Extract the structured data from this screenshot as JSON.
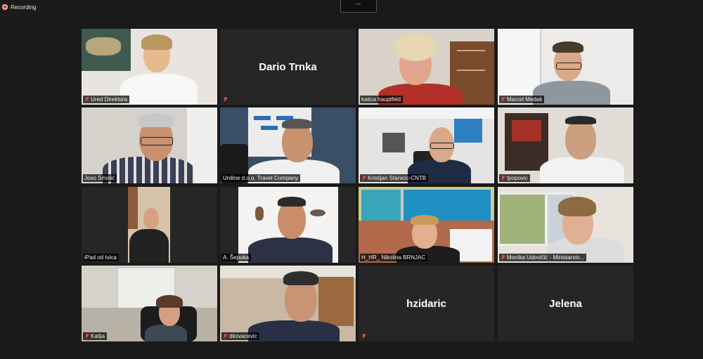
{
  "recording": {
    "label": "Recording"
  },
  "participants": [
    {
      "name": "Ured Direktora",
      "muted": true
    },
    {
      "name": "Dario Trnka",
      "muted": true,
      "video_off": true
    },
    {
      "name": "katica hauptfeld",
      "muted": false
    },
    {
      "name": "Marcel Medak",
      "muted": true
    },
    {
      "name": "Joso Smolić",
      "muted": false
    },
    {
      "name": "Uniline d.o.o. Travel Company",
      "muted": false
    },
    {
      "name": "Kristijan Stanicic-CNTB",
      "muted": true
    },
    {
      "name": "tpopovic",
      "muted": true
    },
    {
      "name": "iPad od Ivica",
      "muted": false
    },
    {
      "name": "A. Šepuka",
      "muted": false
    },
    {
      "name": "H_HR_ Nikolina BRNJAC",
      "muted": false,
      "active_speaker": true
    },
    {
      "name": "Monika Udovičić - Ministarstv...",
      "muted": true
    },
    {
      "name": "Katija",
      "muted": true
    },
    {
      "name": "dkovacevic",
      "muted": true
    },
    {
      "name": "hzidaric",
      "muted": true,
      "video_off": true
    },
    {
      "name": "Jelena",
      "muted": false,
      "video_off": true
    }
  ],
  "colors": {
    "background": "#1a1a1a",
    "active_speaker_border": "#c4dc37",
    "muted_icon": "#e5484d",
    "recording_dot": "#e03a3a"
  }
}
